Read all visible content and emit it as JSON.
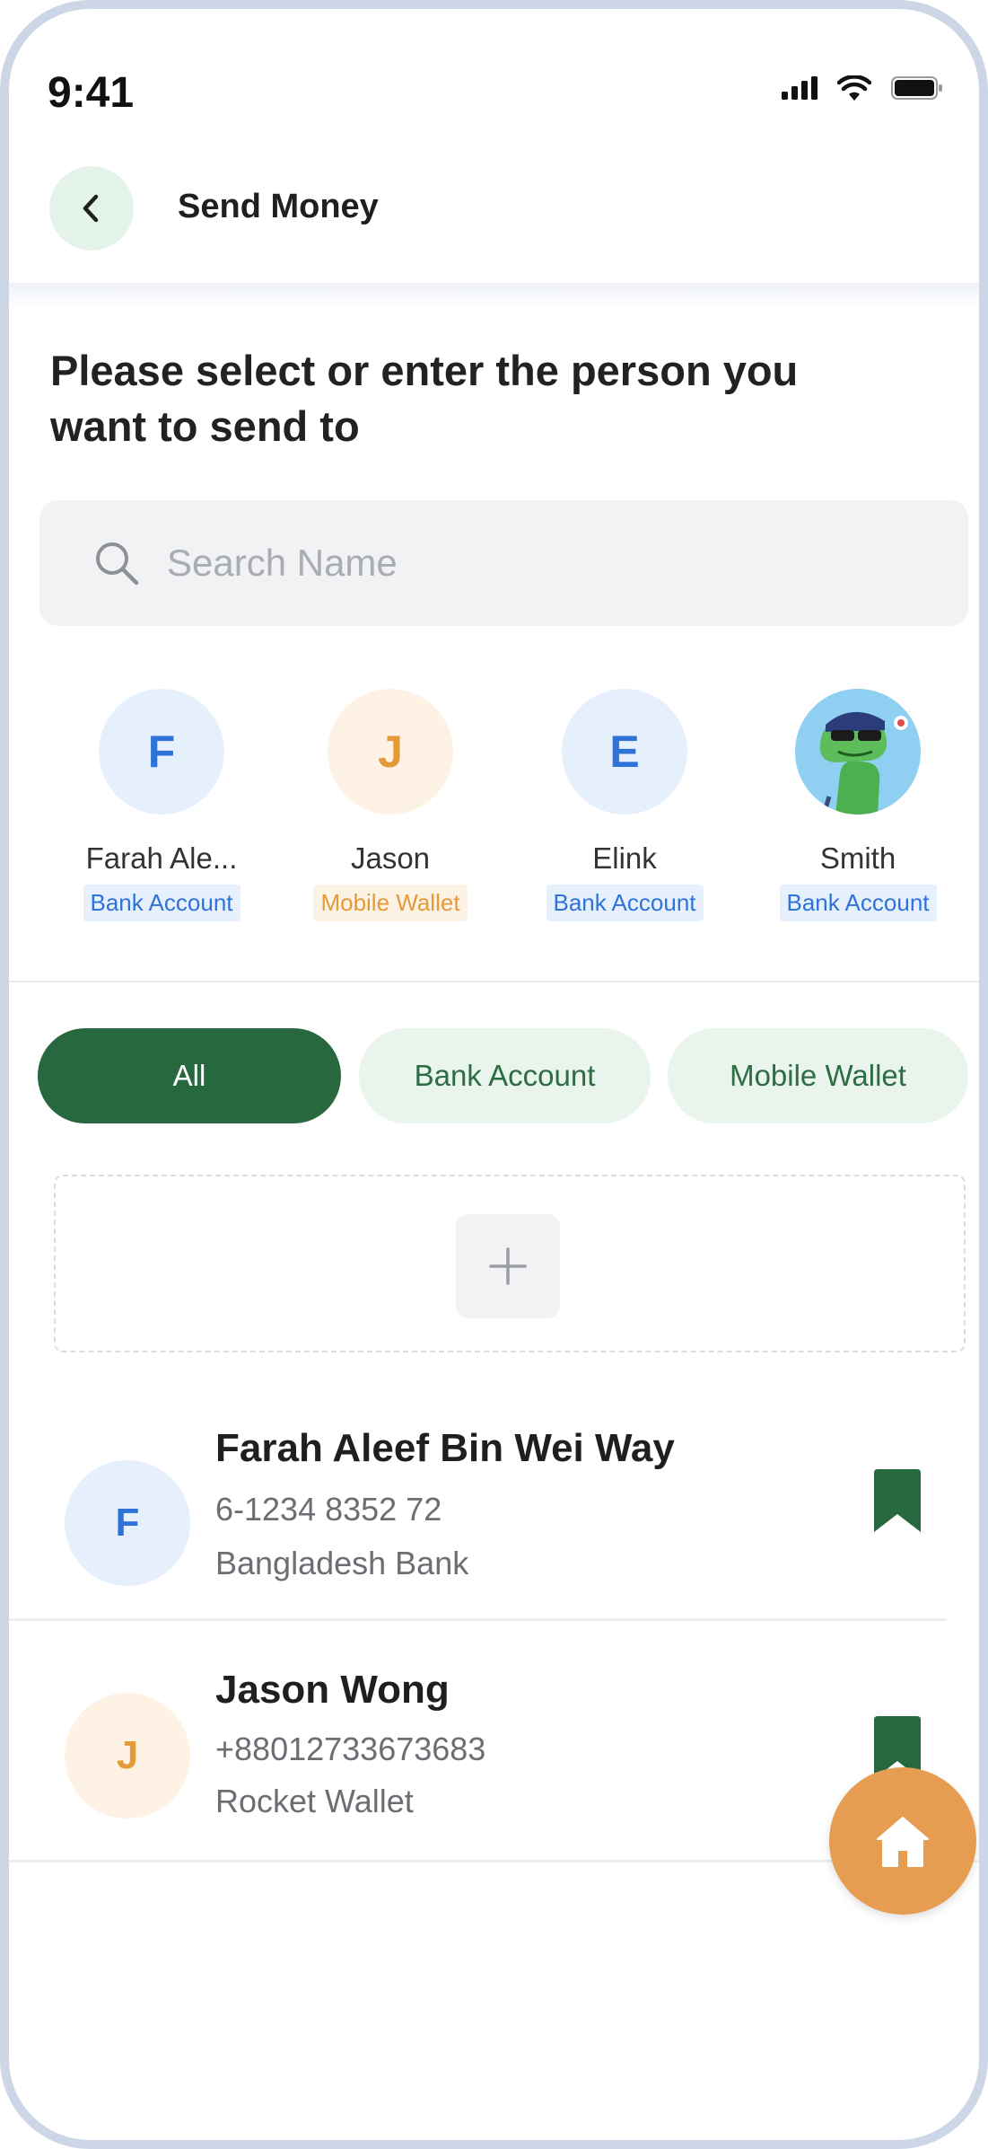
{
  "status_bar": {
    "time": "9:41"
  },
  "header": {
    "title": "Send Money"
  },
  "prompt": "Please select or enter the person you want to send to",
  "search": {
    "placeholder": "Search Name"
  },
  "recent_contacts": [
    {
      "initial": "F",
      "name": "Farah Ale...",
      "type": "Bank Account",
      "avatar": "initial"
    },
    {
      "initial": "J",
      "name": "Jason",
      "type": "Mobile Wallet",
      "avatar": "initial"
    },
    {
      "initial": "E",
      "name": "Elink",
      "type": "Bank Account",
      "avatar": "initial"
    },
    {
      "initial": "",
      "name": "Smith",
      "type": "Bank Account",
      "avatar": "dinosaur-photo"
    }
  ],
  "filters": {
    "tabs": [
      "All",
      "Bank Account",
      "Mobile Wallet"
    ],
    "selected": "All"
  },
  "contacts": [
    {
      "initial": "F",
      "name": "Farah Aleef Bin Wei Way",
      "number": "6-1234 8352 72",
      "institution": "Bangladesh Bank",
      "bookmarked": true
    },
    {
      "initial": "J",
      "name": "Jason Wong",
      "number": "+88012733673683",
      "institution": "Rocket Wallet",
      "bookmarked": true
    }
  ],
  "colors": {
    "primary_green": "#27683f",
    "light_green": "#e9f4ec",
    "bank_blue": "#2f73d9",
    "wallet_orange": "#e59a3a",
    "fab_orange": "#e69d52"
  },
  "icons": {
    "back": "chevron-left-icon",
    "search": "search-icon",
    "add": "plus-icon",
    "bookmark": "bookmark-icon",
    "home": "home-icon"
  }
}
